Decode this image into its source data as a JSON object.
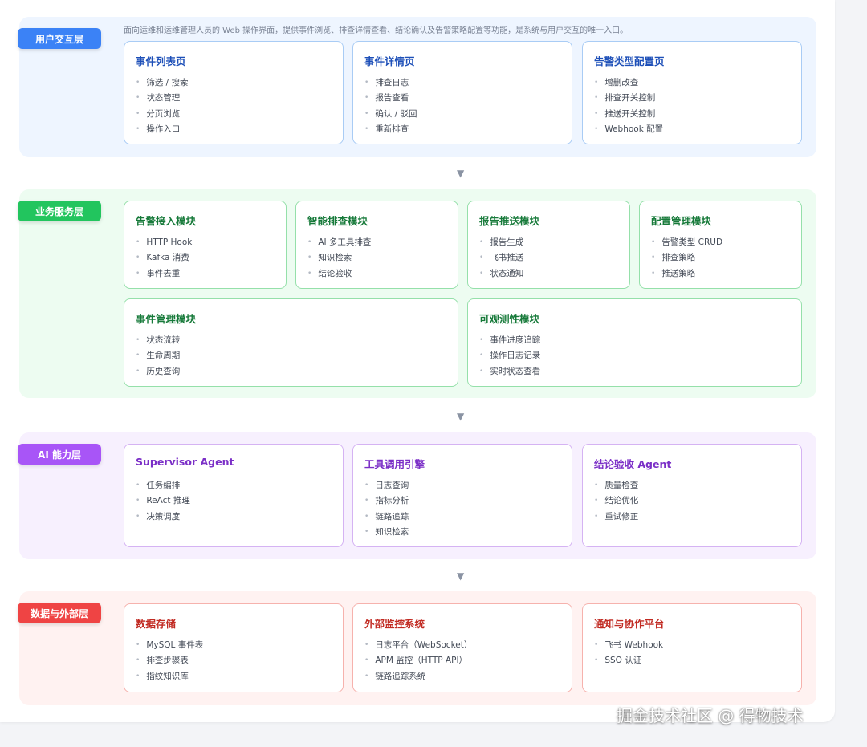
{
  "layers": {
    "user": {
      "badge": "用户交互层",
      "color": "#3b82f6",
      "desc": "面向运维和运维管理人员的 Web 操作界面，提供事件浏览、排查详情查看、结论确认及告警策略配置等功能，是系统与用户交互的唯一入口。",
      "cards": [
        {
          "title": "事件列表页",
          "items": [
            "筛选 / 搜索",
            "状态管理",
            "分页浏览",
            "操作入口"
          ]
        },
        {
          "title": "事件详情页",
          "items": [
            "排查日志",
            "报告查看",
            "确认 / 驳回",
            "重新排查"
          ]
        },
        {
          "title": "告警类型配置页",
          "items": [
            "增删改查",
            "排查开关控制",
            "推送开关控制",
            "Webhook 配置"
          ]
        }
      ]
    },
    "service": {
      "badge": "业务服务层",
      "color": "#22c55e",
      "cards": [
        {
          "title": "告警接入模块",
          "items": [
            "HTTP Hook",
            "Kafka 消费",
            "事件去重"
          ]
        },
        {
          "title": "智能排查模块",
          "items": [
            "AI 多工具排查",
            "知识检索",
            "结论验收"
          ]
        },
        {
          "title": "报告推送模块",
          "items": [
            "报告生成",
            "飞书推送",
            "状态通知"
          ]
        },
        {
          "title": "配置管理模块",
          "items": [
            "告警类型 CRUD",
            "排查策略",
            "推送策略"
          ]
        },
        {
          "title": "事件管理模块",
          "items": [
            "状态流转",
            "生命周期",
            "历史查询"
          ]
        },
        {
          "title": "可观测性模块",
          "items": [
            "事件进度追踪",
            "操作日志记录",
            "实时状态查看"
          ]
        }
      ]
    },
    "ai": {
      "badge": "AI 能力层",
      "color": "#a855f7",
      "cards": [
        {
          "title": "Supervisor Agent",
          "items": [
            "任务编排",
            "ReAct 推理",
            "决策调度"
          ]
        },
        {
          "title": "工具调用引擎",
          "items": [
            "日志查询",
            "指标分析",
            "链路追踪",
            "知识检索"
          ]
        },
        {
          "title": "结论验收 Agent",
          "items": [
            "质量检查",
            "结论优化",
            "重试修正"
          ]
        }
      ]
    },
    "data": {
      "badge": "数据与外部层",
      "color": "#ef4444",
      "cards": [
        {
          "title": "数据存储",
          "items": [
            "MySQL 事件表",
            "排查步骤表",
            "指纹知识库"
          ]
        },
        {
          "title": "外部监控系统",
          "items": [
            "日志平台（WebSocket）",
            "APM 监控（HTTP API）",
            "链路追踪系统"
          ]
        },
        {
          "title": "通知与协作平台",
          "items": [
            "飞书 Webhook",
            "SSO 认证"
          ]
        }
      ]
    }
  },
  "arrow_glyph": "▼",
  "watermark": "掘金技术社区 @ 得物技术"
}
